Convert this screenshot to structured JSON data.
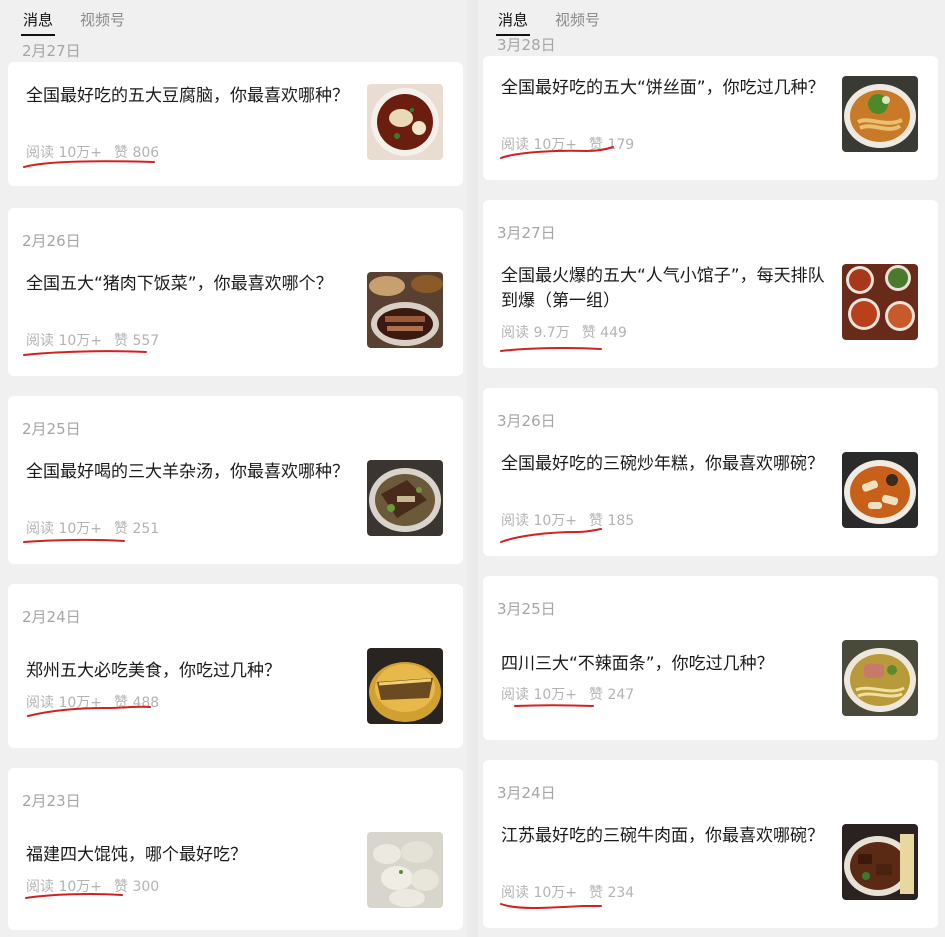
{
  "tabs": {
    "messages": "消息",
    "channels": "视频号"
  },
  "left": [
    {
      "date": "2月27日",
      "title": "全国最好吃的五大豆腐脑，你最喜欢哪种？",
      "read_label": "阅读",
      "reads": "10万+",
      "like_label": "赞",
      "likes": "806"
    },
    {
      "date": "2月26日",
      "title": "全国五大“猪肉下饭菜”，你最喜欢哪个？",
      "read_label": "阅读",
      "reads": "10万+",
      "like_label": "赞",
      "likes": "557"
    },
    {
      "date": "2月25日",
      "title": "全国最好喝的三大羊杂汤，你最喜欢哪种？",
      "read_label": "阅读",
      "reads": "10万+",
      "like_label": "赞",
      "likes": "251"
    },
    {
      "date": "2月24日",
      "title": "郑州五大必吃美食，你吃过几种？",
      "read_label": "阅读",
      "reads": "10万+",
      "like_label": "赞",
      "likes": "488"
    },
    {
      "date": "2月23日",
      "title": "福建四大馄饨，哪个最好吃？",
      "read_label": "阅读",
      "reads": "10万+",
      "like_label": "赞",
      "likes": "300"
    }
  ],
  "right": [
    {
      "date": "3月28日",
      "title": "全国最好吃的五大“饼丝面”，你吃过几种？",
      "read_label": "阅读",
      "reads": "10万+",
      "like_label": "赞",
      "likes": "179"
    },
    {
      "date": "3月27日",
      "title": "全国最火爆的五大“人气小馆子”，每天排队到爆（第一组）",
      "read_label": "阅读",
      "reads": "9.7万",
      "like_label": "赞",
      "likes": "449"
    },
    {
      "date": "3月26日",
      "title": "全国最好吃的三碗炒年糕，你最喜欢哪碗？",
      "read_label": "阅读",
      "reads": "10万+",
      "like_label": "赞",
      "likes": "185"
    },
    {
      "date": "3月25日",
      "title": "四川三大“不辣面条”，你吃过几种？",
      "read_label": "阅读",
      "reads": "10万+",
      "like_label": "赞",
      "likes": "247"
    },
    {
      "date": "3月24日",
      "title": "江苏最好吃的三碗牛肉面，你最喜欢哪碗？",
      "read_label": "阅读",
      "reads": "10万+",
      "like_label": "赞",
      "likes": "234"
    }
  ],
  "colors": {
    "annotation": "#d42020",
    "card": "#ffffff",
    "date": "#a5a5a5",
    "stats": "#b3b3b3"
  },
  "thumbnail_icons": [
    "tofu-pudding-photo",
    "pork-dish-photo",
    "mutton-soup-photo",
    "zhengzhou-food-photo",
    "wonton-photo",
    "noodle-bowl-photo",
    "restaurant-dishes-photo",
    "rice-cake-photo",
    "noodle-soup-photo",
    "beef-noodle-photo"
  ]
}
